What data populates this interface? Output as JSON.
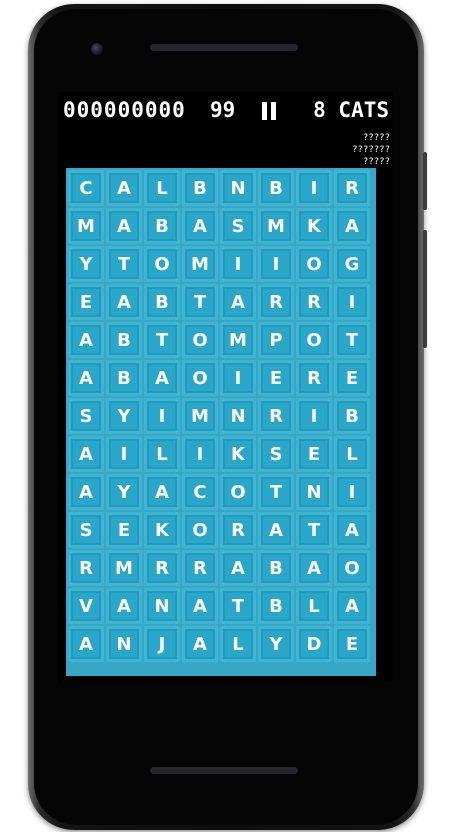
{
  "hud": {
    "score": "000000000",
    "timer": "99",
    "categories": "8 CATS"
  },
  "clues": [
    "?????",
    "???????",
    "?????"
  ],
  "colors": {
    "tile": "#2aa6c8",
    "tile_border": "#3fb3d2",
    "board": "#36a7c6",
    "screen": "#000000"
  },
  "grid": {
    "rows": [
      [
        "C",
        "A",
        "L",
        "B",
        "N",
        "B",
        "I",
        "R"
      ],
      [
        "M",
        "A",
        "B",
        "A",
        "S",
        "M",
        "K",
        "A"
      ],
      [
        "Y",
        "T",
        "O",
        "M",
        "I",
        "I",
        "O",
        "G"
      ],
      [
        "E",
        "A",
        "B",
        "T",
        "A",
        "R",
        "R",
        "I"
      ],
      [
        "A",
        "B",
        "T",
        "O",
        "M",
        "P",
        "O",
        "T"
      ],
      [
        "A",
        "B",
        "A",
        "O",
        "I",
        "E",
        "R",
        "E"
      ],
      [
        "S",
        "Y",
        "I",
        "M",
        "N",
        "R",
        "I",
        "B"
      ],
      [
        "A",
        "I",
        "L",
        "I",
        "K",
        "S",
        "E",
        "L"
      ],
      [
        "A",
        "Y",
        "A",
        "C",
        "O",
        "T",
        "N",
        "I"
      ],
      [
        "S",
        "E",
        "K",
        "O",
        "R",
        "A",
        "T",
        "A"
      ],
      [
        "R",
        "M",
        "R",
        "R",
        "A",
        "B",
        "A",
        "O"
      ],
      [
        "V",
        "A",
        "N",
        "A",
        "T",
        "B",
        "L",
        "A"
      ],
      [
        "A",
        "N",
        "J",
        "A",
        "L",
        "Y",
        "D",
        "E"
      ]
    ]
  }
}
